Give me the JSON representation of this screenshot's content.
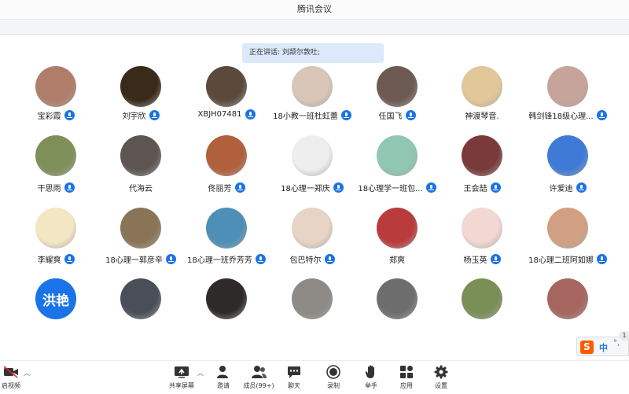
{
  "window": {
    "title": "腾讯会议"
  },
  "speaking": {
    "text": "正在讲话: 刘颉尔敦吐;"
  },
  "participants": [
    {
      "name": "宝彩霞",
      "mic": true,
      "color": "#b07d6a"
    },
    {
      "name": "刘宇欣",
      "mic": true,
      "color": "#3a2a1a"
    },
    {
      "name": "XBJH07481",
      "mic": true,
      "color": "#5b4a3c"
    },
    {
      "name": "18小教一班杜虹蕾",
      "mic": true,
      "color": "#d9c6b8"
    },
    {
      "name": "任国飞",
      "mic": true,
      "color": "#6d5a53"
    },
    {
      "name": "神渡琴音.",
      "mic": false,
      "color": "#e2c79a"
    },
    {
      "name": "韩剑锋18级心理...",
      "mic": true,
      "color": "#c7a49a"
    },
    {
      "name": "干思雨",
      "mic": true,
      "color": "#7f8f5a"
    },
    {
      "name": "代海云",
      "mic": false,
      "color": "#5c5552"
    },
    {
      "name": "佟丽芳",
      "mic": true,
      "color": "#b0603a"
    },
    {
      "name": "18心理一郑庆",
      "mic": true,
      "color": "#eeeeee"
    },
    {
      "name": "18心理学一班包...",
      "mic": true,
      "color": "#8fc7b2"
    },
    {
      "name": "王会喆",
      "mic": true,
      "color": "#7a3a3a"
    },
    {
      "name": "许爱迪",
      "mic": true,
      "color": "#3f7bd6"
    },
    {
      "name": "李耀爽",
      "mic": true,
      "color": "#f3e7c3"
    },
    {
      "name": "18心理一郭彦辛",
      "mic": true,
      "color": "#8a7458"
    },
    {
      "name": "18心理一班乔芳芳",
      "mic": true,
      "color": "#4d8fb6"
    },
    {
      "name": "包巴特尔",
      "mic": true,
      "color": "#e7d4c6"
    },
    {
      "name": "郑爽",
      "mic": false,
      "color": "#b93b3b"
    },
    {
      "name": "杨玉英",
      "mic": true,
      "color": "#f2d7d2"
    },
    {
      "name": "18心理二班阿如娜",
      "mic": true,
      "color": "#d1a082"
    },
    {
      "name": "",
      "mic": false,
      "color": "#1a73e8",
      "avatar_text": "洪艳"
    },
    {
      "name": "",
      "mic": false,
      "color": "#4a4e58"
    },
    {
      "name": "",
      "mic": false,
      "color": "#2e2a29"
    },
    {
      "name": "",
      "mic": false,
      "color": "#8d8a85"
    },
    {
      "name": "",
      "mic": false,
      "color": "#6d6d6d"
    },
    {
      "name": "",
      "mic": false,
      "color": "#7a8f56"
    },
    {
      "name": "",
      "mic": false,
      "color": "#a6655e"
    }
  ],
  "toolbar": {
    "video": "启视频",
    "share": "共享屏幕",
    "invite": "邀请",
    "members": "成员(99+)",
    "chat": "聊天",
    "record": "录制",
    "raise": "举手",
    "apps": "应用",
    "settings": "设置"
  },
  "ime": {
    "logo": "S",
    "mode": "中",
    "badge": "1"
  },
  "colors": {
    "accent": "#1b73e8",
    "speaking_bg": "#dbe9fa"
  }
}
